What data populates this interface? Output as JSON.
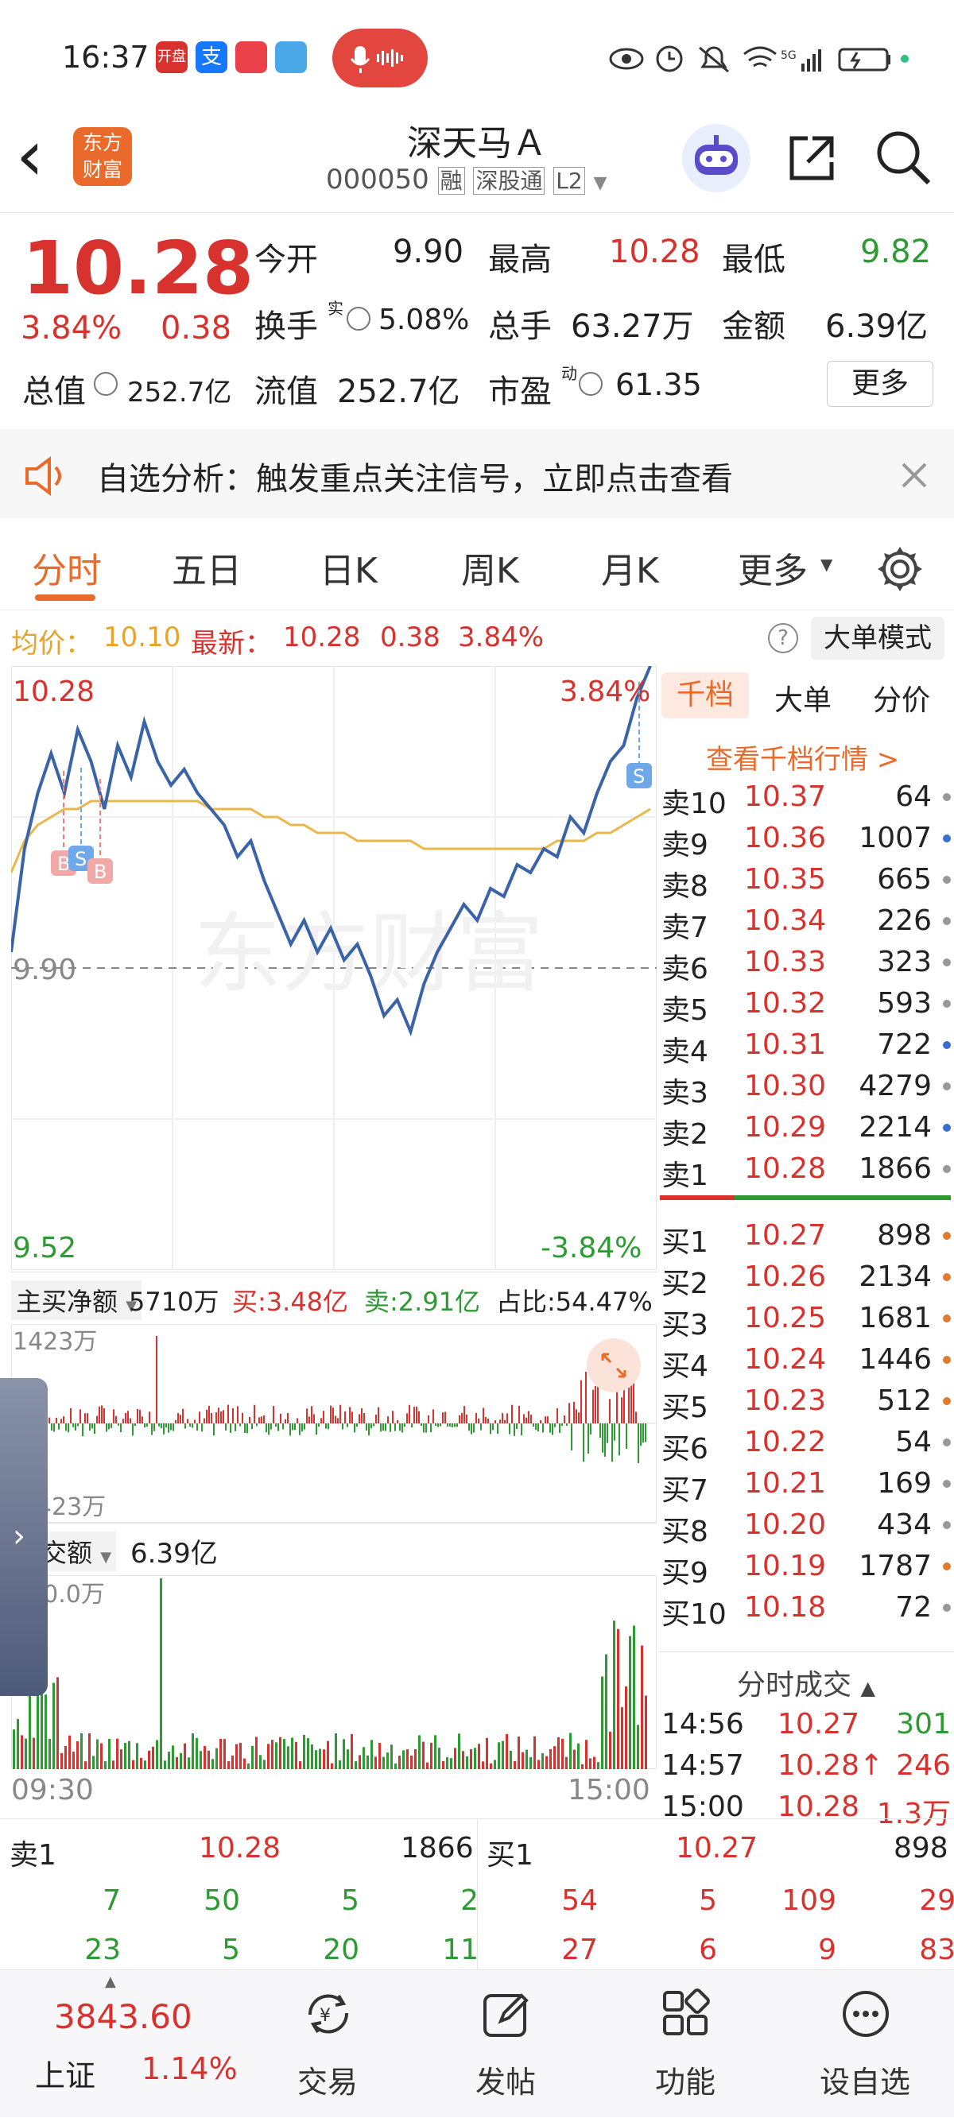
{
  "status": {
    "time": "16:37",
    "app_icons": [
      "开盘",
      "支",
      "",
      ""
    ],
    "network": "5G"
  },
  "header": {
    "back": "‹",
    "logo_line1": "东方",
    "logo_line2": "财富",
    "title": "深天马Ａ",
    "code": "000050",
    "badges": [
      "融",
      "深股通",
      "L2"
    ]
  },
  "quote": {
    "price": "10.28",
    "change_pct": "3.84%",
    "change": "0.38",
    "open_label": "今开",
    "open": "9.90",
    "high_label": "最高",
    "high": "10.28",
    "low_label": "最低",
    "low": "9.82",
    "turnover_label": "换手",
    "turnover_sup": "实",
    "turnover": "5.08%",
    "volume_label": "总手",
    "volume": "63.27万",
    "amount_label": "金额",
    "amount": "6.39亿",
    "mktcap_label": "总值",
    "mktcap": "252.7亿",
    "float_label": "流值",
    "float": "252.7亿",
    "pe_label": "市盈",
    "pe_sup": "动",
    "pe": "61.35",
    "more": "更多"
  },
  "notice": {
    "text": "自选分析：触发重点关注信号，立即点击查看"
  },
  "tabs": [
    "分时",
    "五日",
    "日K",
    "周K",
    "月K",
    "更多"
  ],
  "avgbar": {
    "avg_label": "均价：",
    "avg": "10.10",
    "latest_label": "最新：",
    "latest": "10.28",
    "chg": "0.38",
    "pct": "3.84%",
    "help": "?",
    "mode": "大单模式"
  },
  "chart": {
    "top_price": "10.28",
    "top_pct": "3.84%",
    "mid_price": "9.90",
    "bottom_price": "9.52",
    "bottom_pct": "-3.84%",
    "watermark": "东方财富",
    "markers": [
      "B",
      "S",
      "B",
      "S"
    ],
    "flow_title": "主买净额",
    "flow_value": "5710万",
    "buy_label": "买:3.48亿",
    "sell_label": "卖:2.91亿",
    "ratio_label": "占比:54.47%",
    "flow_max": "1423万",
    "flow_min": "-1423万",
    "amount_title": "成交额",
    "amount_value": "6.39亿",
    "amount_max": "280.0万",
    "time_start": "09:30",
    "time_end": "15:00"
  },
  "chart_data": {
    "type": "line",
    "title": "",
    "xlabel": "",
    "ylabel": "",
    "x_range": [
      "09:30",
      "15:00"
    ],
    "ylim": [
      9.52,
      10.28
    ],
    "prev_close": 9.9,
    "series": [
      {
        "name": "",
        "values": [
          9.92,
          10.05,
          10.12,
          10.17,
          10.12,
          10.2,
          10.16,
          10.1,
          10.18,
          10.14,
          10.21,
          10.16,
          10.13,
          10.15,
          10.12,
          10.1,
          10.08,
          10.04,
          10.06,
          10.01,
          9.97,
          9.93,
          9.96,
          9.92,
          9.95,
          9.91,
          9.93,
          9.89,
          9.84,
          9.86,
          9.82,
          9.88,
          9.92,
          9.95,
          9.98,
          9.96,
          10.0,
          9.99,
          10.03,
          10.02,
          10.05,
          10.04,
          10.09,
          10.07,
          10.12,
          10.16,
          10.18,
          10.24,
          10.28
        ]
      },
      {
        "name": "",
        "values": [
          10.02,
          10.06,
          10.08,
          10.09,
          10.1,
          10.1,
          10.11,
          10.11,
          10.11,
          10.11,
          10.11,
          10.11,
          10.11,
          10.11,
          10.11,
          10.1,
          10.1,
          10.1,
          10.1,
          10.09,
          10.09,
          10.08,
          10.08,
          10.07,
          10.07,
          10.07,
          10.06,
          10.06,
          10.06,
          10.06,
          10.06,
          10.05,
          10.05,
          10.05,
          10.05,
          10.05,
          10.05,
          10.05,
          10.05,
          10.05,
          10.05,
          10.06,
          10.06,
          10.06,
          10.07,
          10.07,
          10.08,
          10.09,
          10.1
        ]
      }
    ]
  },
  "book": {
    "tabs": [
      "千档",
      "大单",
      "分价"
    ],
    "link": "查看千档行情 >",
    "asks": [
      {
        "label": "卖10",
        "price": "10.37",
        "vol": "64",
        "dot": "#999"
      },
      {
        "label": "卖9",
        "price": "10.36",
        "vol": "1007",
        "dot": "#3a6fd0"
      },
      {
        "label": "卖8",
        "price": "10.35",
        "vol": "665",
        "dot": "#999"
      },
      {
        "label": "卖7",
        "price": "10.34",
        "vol": "226",
        "dot": "#999"
      },
      {
        "label": "卖6",
        "price": "10.33",
        "vol": "323",
        "dot": "#999"
      },
      {
        "label": "卖5",
        "price": "10.32",
        "vol": "593",
        "dot": "#999"
      },
      {
        "label": "卖4",
        "price": "10.31",
        "vol": "722",
        "dot": "#3a6fd0"
      },
      {
        "label": "卖3",
        "price": "10.30",
        "vol": "4279",
        "dot": "#999"
      },
      {
        "label": "卖2",
        "price": "10.29",
        "vol": "2214",
        "dot": "#3a6fd0"
      },
      {
        "label": "卖1",
        "price": "10.28",
        "vol": "1866",
        "dot": "#999"
      }
    ],
    "bids": [
      {
        "label": "买1",
        "price": "10.27",
        "vol": "898",
        "dot": "#e07a2e"
      },
      {
        "label": "买2",
        "price": "10.26",
        "vol": "2134",
        "dot": "#e07a2e"
      },
      {
        "label": "买3",
        "price": "10.25",
        "vol": "1681",
        "dot": "#e07a2e"
      },
      {
        "label": "买4",
        "price": "10.24",
        "vol": "1446",
        "dot": "#e07a2e"
      },
      {
        "label": "买5",
        "price": "10.23",
        "vol": "512",
        "dot": "#e07a2e"
      },
      {
        "label": "买6",
        "price": "10.22",
        "vol": "54",
        "dot": "#999"
      },
      {
        "label": "买7",
        "price": "10.21",
        "vol": "169",
        "dot": "#999"
      },
      {
        "label": "买8",
        "price": "10.20",
        "vol": "434",
        "dot": "#999"
      },
      {
        "label": "买9",
        "price": "10.19",
        "vol": "1787",
        "dot": "#e07a2e"
      },
      {
        "label": "买10",
        "price": "10.18",
        "vol": "72",
        "dot": "#999"
      }
    ],
    "trades_title": "分时成交",
    "trades": [
      {
        "time": "14:56",
        "price": "10.27",
        "vol": "301",
        "vol_color": "#2e9a33",
        "arrow": ""
      },
      {
        "time": "14:57",
        "price": "10.28",
        "vol": "246",
        "vol_color": "#d7322e",
        "arrow": "↑"
      },
      {
        "time": "15:00",
        "price": "10.28",
        "vol": "1.3万",
        "vol_color": "#d7322e",
        "arrow": ""
      }
    ]
  },
  "bottom_quote": {
    "ask_label": "卖1",
    "ask_price": "10.28",
    "ask_vol": "1866",
    "bid_label": "买1",
    "bid_price": "10.27",
    "bid_vol": "898",
    "ask_q1": [
      "7",
      "50",
      "5",
      "2"
    ],
    "ask_q2": [
      "23",
      "5",
      "20",
      "11"
    ],
    "bid_q1": [
      "54",
      "5",
      "109",
      "29"
    ],
    "bid_q2": [
      "27",
      "6",
      "9",
      "83"
    ]
  },
  "nav": {
    "index_value": "3843.60",
    "index_name": "上证",
    "index_pct": "1.14%",
    "items": [
      "交易",
      "发帖",
      "功能",
      "设自选"
    ]
  },
  "colors": {
    "up": "#d7322e",
    "down": "#2e9a33",
    "line": "#3a63a8",
    "avg": "#e8b84a",
    "accent": "#e96a2a"
  }
}
